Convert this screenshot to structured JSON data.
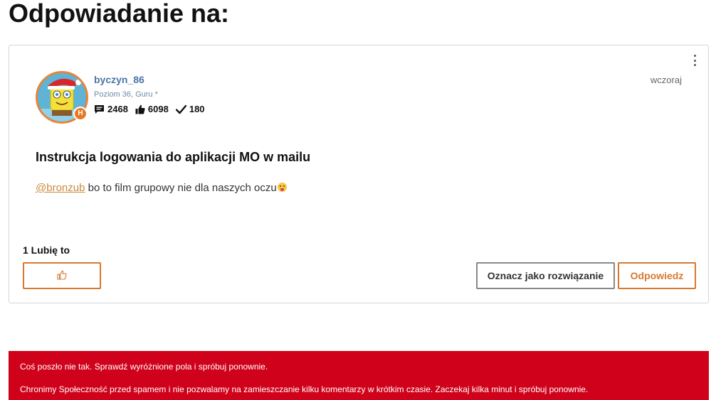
{
  "page": {
    "title": "Odpowiadanie na:"
  },
  "post": {
    "author": {
      "username": "byczyn_86",
      "rank": "Poziom 36, Guru *",
      "rank_badge": "H",
      "stats": {
        "posts": "2468",
        "likes": "6098",
        "solutions": "180"
      }
    },
    "date": "wczoraj",
    "subject": "Instrukcja logowania do aplikacji MO w mailu",
    "body": {
      "mention": "@bronzub",
      "text": " bo to film grupowy nie dla naszych oczu"
    },
    "likes_label": "1 Lubię to",
    "actions": {
      "mark_solution": "Oznacz jako rozwiązanie",
      "reply": "Odpowiedz"
    },
    "icons": {
      "menu": "more-vertical-icon",
      "posts": "comment-icon",
      "likes": "thumbs-up-icon",
      "solutions": "checkmark-icon",
      "like_button": "thumbs-up-outline-icon"
    }
  },
  "error": {
    "line1": "Coś poszło nie tak. Sprawdź wyróżnione pola i spróbuj ponownie.",
    "line2": "Chronimy Społeczność przed spamem i nie pozwalamy na zamieszczanie kilku komentarzy w krótkim czasie. Zaczekaj kilka minut i spróbuj ponownie."
  },
  "colors": {
    "accent_orange": "#d9782e",
    "username_blue": "#4a75a6",
    "error_red": "#d0021b"
  }
}
